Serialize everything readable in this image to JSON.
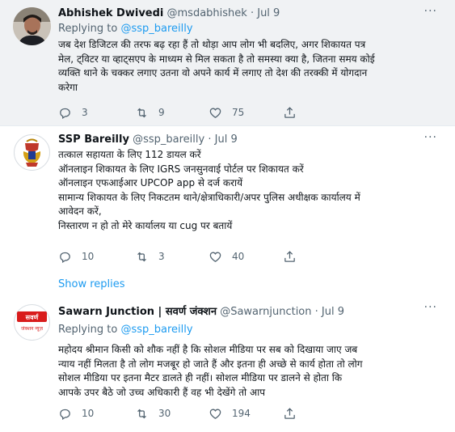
{
  "tweets": [
    {
      "name": "Abhishek Dwivedi",
      "handle": "@msdabhishek",
      "dot": "·",
      "date": "Jul 9",
      "more": "···",
      "replying_prefix": "Replying to ",
      "replying_handle": "@ssp_bareilly",
      "lines": [
        "जब देश डिजिटल की तरफ बढ़ रहा हैं तो थोड़ा आप लोग भी बदलिए, अगर शिकायत पत्र",
        "मेल, ट्विटर या व्हाट्सएप के माध्यम से मिल सकता है तो समस्या क्या है, जितना समय कोई",
        "व्यक्ति थाने के चक्कर लगाए उतना वो अपने कार्य में लगाए तो देश की तरक्की में योगदान",
        "करेगा"
      ],
      "replies": "3",
      "retweets": "9",
      "likes": "75"
    },
    {
      "name": "SSP Bareilly",
      "handle": "@ssp_bareilly",
      "dot": "·",
      "date": "Jul 9",
      "more": "···",
      "lines": [
        "तत्काल सहायता के लिए 112 डायल करें",
        "ऑनलाइन शिकायत के लिए IGRS जनसुनवाई पोर्टल पर शिकायत करें",
        "ऑनलाइन एफआईआर  UPCOP app से दर्ज करायें",
        "सामान्य शिकायत के लिए निकटतम थाने/क्षेत्राधिकारी/अपर पुलिस अधीक्षक कार्यालय में",
        "आवेदन करें,",
        "निस्तारण न हो तो मेरे कार्यालय या  cug पर बतायें"
      ],
      "replies": "10",
      "retweets": "3",
      "likes": "40",
      "show_replies": "Show replies"
    },
    {
      "name": "Sawarn Junction | सवर्ण जंक्शन",
      "handle": "@Sawarnjunction",
      "dot": "·",
      "date": "Jul 9",
      "more": "···",
      "replying_prefix": "Replying to ",
      "replying_handle": "@ssp_bareilly",
      "lines": [
        "महोदय श्रीमान किसी को शौक नहीं है कि सोशल मीडिया पर सब को दिखाया जाए जब",
        "न्याय नहीं मिलता है तो लोग मजबूर हो जाते हैं और इतना ही अच्छे से कार्य होता तो लोग",
        "सोशल मीडिया पर इतना मैटर डालते ही नहीं। सोशल मीडिया पर डालने से होता कि",
        "आपके उपर बैठे जो उच्च अधिकारी हैं वह भी देखेंगे तो आप"
      ],
      "replies": "10",
      "retweets": "30",
      "likes": "194",
      "avatar_text": [
        "सवर्ण",
        "जंक्शन न्यूज़"
      ]
    }
  ],
  "colors": {
    "link": "#1d9bf0",
    "muted": "#536471",
    "text": "#0f1419",
    "highlight_bg": "#f0f2f4"
  },
  "icons": [
    "reply-icon",
    "retweet-icon",
    "like-icon",
    "share-icon",
    "more-icon"
  ]
}
